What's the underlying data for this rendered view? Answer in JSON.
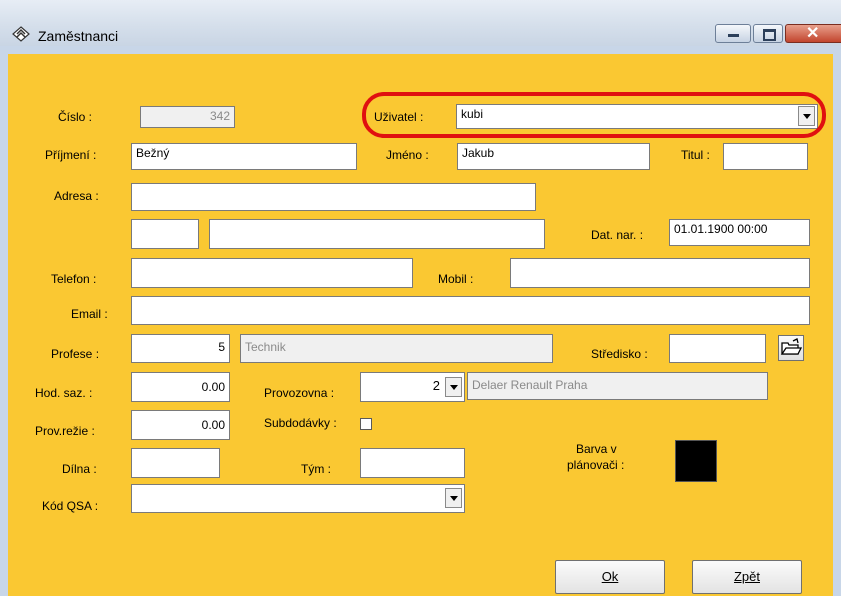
{
  "window": {
    "title": "Zaměstnanci"
  },
  "form": {
    "cislo": {
      "label": "Číslo :",
      "value": "342"
    },
    "uzivatel": {
      "label": "Uživatel :",
      "value": "kubi"
    },
    "prijmeni": {
      "label": "Příjmení :",
      "value": "Bežný"
    },
    "jmeno": {
      "label": "Jméno :",
      "value": "Jakub"
    },
    "titul": {
      "label": "Titul :",
      "value": ""
    },
    "adresa": {
      "label": "Adresa :",
      "value": ""
    },
    "psc": {
      "value": ""
    },
    "mesto": {
      "value": ""
    },
    "dat_nar": {
      "label": "Dat. nar. :",
      "value": "01.01.1900 00:00"
    },
    "telefon": {
      "label": "Telefon :",
      "value": ""
    },
    "mobil": {
      "label": "Mobil :",
      "value": ""
    },
    "email": {
      "label": "Email :",
      "value": ""
    },
    "profese": {
      "label": "Profese :",
      "code": "5",
      "name": "Technik"
    },
    "stredisko": {
      "label": "Středisko :",
      "value": ""
    },
    "hod_saz": {
      "label": "Hod. saz. :",
      "value": "0.00"
    },
    "provozovna": {
      "label": "Provozovna :",
      "code": "2",
      "name": "Delaer Renault Praha"
    },
    "prov_rezie": {
      "label": "Prov.režie :",
      "value": "0.00"
    },
    "subdodavky": {
      "label": "Subdodávky :",
      "checked": false
    },
    "dilna": {
      "label": "Dílna :",
      "value": ""
    },
    "tym": {
      "label": "Tým :",
      "value": ""
    },
    "barva": {
      "label_line1": "Barva v",
      "label_line2": "plánovači :",
      "color": "#000000"
    },
    "kod_qsa": {
      "label": "Kód QSA :",
      "value": ""
    }
  },
  "buttons": {
    "ok": "Ok",
    "zpet": "Zpět"
  },
  "colors": {
    "background": "#fac832",
    "highlight": "#e01010"
  }
}
